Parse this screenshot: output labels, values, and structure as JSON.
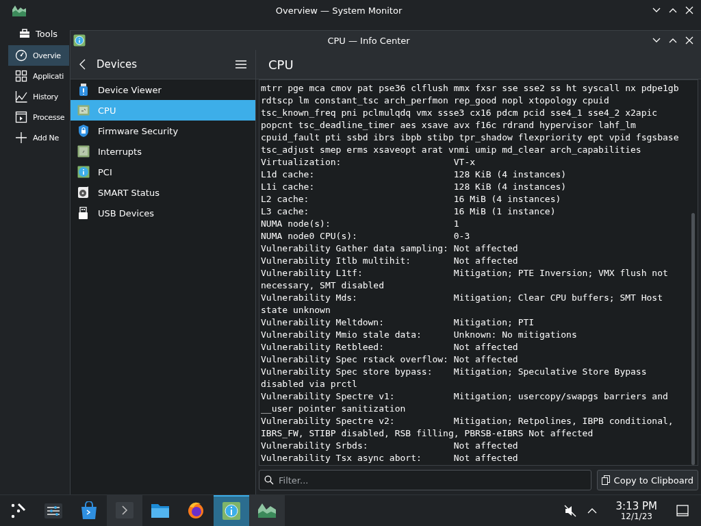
{
  "system_monitor": {
    "title": "Overview — System Monitor",
    "tools": "Tools",
    "sidebar": [
      {
        "label": "Overvie",
        "kind": "gauge",
        "selected": true
      },
      {
        "label": "Applicati",
        "kind": "grid",
        "selected": false
      },
      {
        "label": "History",
        "kind": "chart",
        "selected": false
      },
      {
        "label": "Processe",
        "kind": "terminal",
        "selected": false
      },
      {
        "label": "Add Ne",
        "kind": "plus",
        "selected": false
      }
    ]
  },
  "info_center": {
    "title": "CPU — Info Center",
    "sidebar_header": "Devices",
    "modules": [
      {
        "label": "Device Viewer",
        "kind": "device",
        "selected": false
      },
      {
        "label": "CPU",
        "kind": "cpu",
        "selected": true
      },
      {
        "label": "Firmware Security",
        "kind": "shield",
        "selected": false
      },
      {
        "label": "Interrupts",
        "kind": "chip",
        "selected": false
      },
      {
        "label": "PCI",
        "kind": "info",
        "selected": false
      },
      {
        "label": "SMART Status",
        "kind": "disk",
        "selected": false
      },
      {
        "label": "USB Devices",
        "kind": "usb",
        "selected": false
      }
    ],
    "page_title": "CPU",
    "lines": [
      {
        "text": "mtrr pge mca cmov pat pse36 clflush mmx fxsr sse sse2 ss ht syscall nx pdpe1gb"
      },
      {
        "text": "rdtscp lm constant_tsc arch_perfmon rep_good nopl xtopology cpuid"
      },
      {
        "text": "tsc_known_freq pni pclmulqdq vmx ssse3 cx16 pdcm pcid sse4_1 sse4_2 x2apic"
      },
      {
        "text": "popcnt tsc_deadline_timer aes xsave avx f16c rdrand hypervisor lahf_lm"
      },
      {
        "text": "cpuid_fault pti ssbd ibrs ibpb stibp tpr_shadow flexpriority ept vpid fsgsbase"
      },
      {
        "text": "tsc_adjust smep erms xsaveopt arat vnmi umip md_clear arch_capabilities"
      },
      {
        "label": "Virtualization:",
        "value": "VT-x"
      },
      {
        "label": "L1d cache:",
        "value": "128 KiB (4 instances)"
      },
      {
        "label": "L1i cache:",
        "value": "128 KiB (4 instances)"
      },
      {
        "label": "L2 cache:",
        "value": "16 MiB (4 instances)"
      },
      {
        "label": "L3 cache:",
        "value": "16 MiB (1 instance)"
      },
      {
        "label": "NUMA node(s):",
        "value": "1"
      },
      {
        "label": "NUMA node0 CPU(s):",
        "value": "0-3"
      },
      {
        "label": "Vulnerability Gather data sampling:",
        "value": "Not affected"
      },
      {
        "label": "Vulnerability Itlb multihit:",
        "value": "Not affected"
      },
      {
        "label": "Vulnerability L1tf:",
        "value": "Mitigation; PTE Inversion; VMX flush not necessary, SMT disabled"
      },
      {
        "label": "Vulnerability Mds:",
        "value": "Mitigation; Clear CPU buffers; SMT Host state unknown"
      },
      {
        "label": "Vulnerability Meltdown:",
        "value": "Mitigation; PTI"
      },
      {
        "label": "Vulnerability Mmio stale data:",
        "value": "Unknown: No mitigations"
      },
      {
        "label": "Vulnerability Retbleed:",
        "value": "Not affected"
      },
      {
        "label": "Vulnerability Spec rstack overflow:",
        "value": "Not affected"
      },
      {
        "label": "Vulnerability Spec store bypass:",
        "value": "Mitigation; Speculative Store Bypass disabled via prctl"
      },
      {
        "label": "Vulnerability Spectre v1:",
        "value": "Mitigation; usercopy/swapgs barriers and __user pointer sanitization"
      },
      {
        "label": "Vulnerability Spectre v2:",
        "value": "Mitigation; Retpolines, IBPB conditional, IBRS_FW, STIBP disabled, RSB filling, PBRSB-eIBRS Not affected"
      },
      {
        "label": "Vulnerability Srbds:",
        "value": "Not affected"
      },
      {
        "label": "Vulnerability Tsx async abort:",
        "value": "Not affected"
      }
    ],
    "filter": {
      "placeholder": "Filter..."
    },
    "copy_button": "Copy to Clipboard"
  },
  "taskbar": {
    "apps": [
      {
        "kind": "launcher",
        "open": false,
        "selected": false
      },
      {
        "kind": "settings",
        "open": false,
        "selected": false
      },
      {
        "kind": "store",
        "open": false,
        "selected": false
      },
      {
        "kind": "terminal",
        "open": true,
        "selected": false
      },
      {
        "kind": "files",
        "open": false,
        "selected": false
      },
      {
        "kind": "browser",
        "open": false,
        "selected": false
      },
      {
        "kind": "info",
        "open": true,
        "selected": true
      },
      {
        "kind": "monitor",
        "open": true,
        "selected": false
      }
    ],
    "clock": {
      "time": "3:13 PM",
      "date": "12/1/23"
    }
  }
}
